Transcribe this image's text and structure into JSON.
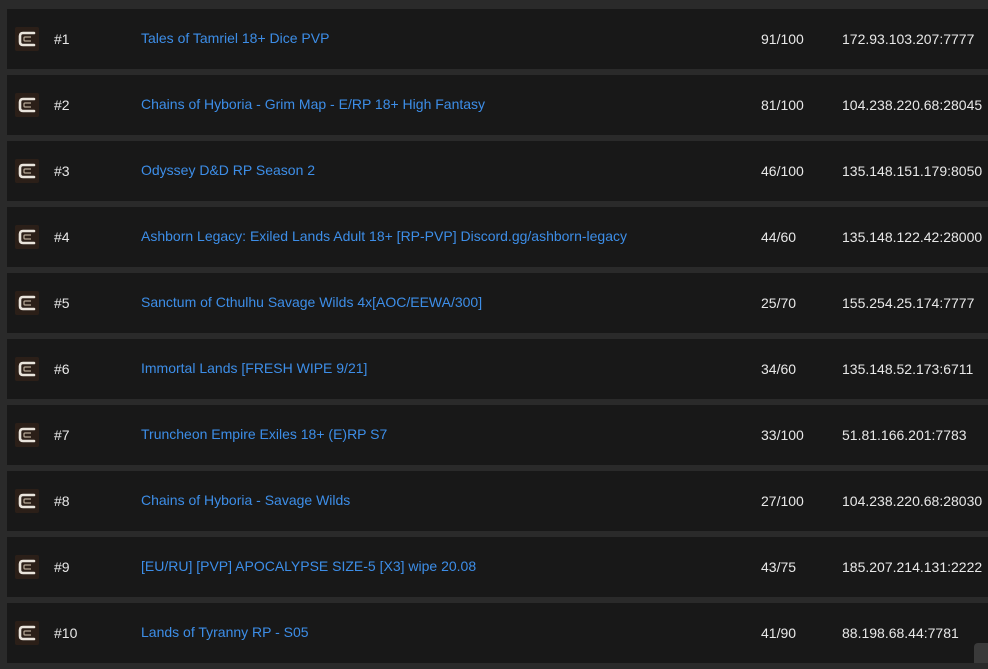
{
  "servers": [
    {
      "rank": "#1",
      "name": "Tales of Tamriel 18+ Dice PVP",
      "players": "91/100",
      "address": "172.93.103.207:7777",
      "icon": "game-logo-icon"
    },
    {
      "rank": "#2",
      "name": "Chains of Hyboria - Grim Map - E/RP 18+ High Fantasy",
      "players": "81/100",
      "address": "104.238.220.68:28045",
      "icon": "game-logo-icon"
    },
    {
      "rank": "#3",
      "name": "Odyssey D&D RP Season 2",
      "players": "46/100",
      "address": "135.148.151.179:8050",
      "icon": "game-logo-icon"
    },
    {
      "rank": "#4",
      "name": "Ashborn Legacy: Exiled Lands Adult 18+ [RP-PVP] Discord.gg/ashborn-legacy",
      "players": "44/60",
      "address": "135.148.122.42:28000",
      "icon": "game-logo-icon"
    },
    {
      "rank": "#5",
      "name": "Sanctum of Cthulhu Savage Wilds 4x[AOC/EEWA/300]",
      "players": "25/70",
      "address": "155.254.25.174:7777",
      "icon": "game-logo-icon"
    },
    {
      "rank": "#6",
      "name": "Immortal Lands [FRESH WIPE 9/21]",
      "players": "34/60",
      "address": "135.148.52.173:6711",
      "icon": "game-logo-icon"
    },
    {
      "rank": "#7",
      "name": "Truncheon Empire Exiles 18+ (E)RP S7",
      "players": "33/100",
      "address": "51.81.166.201:7783",
      "icon": "game-logo-icon"
    },
    {
      "rank": "#8",
      "name": "Chains of Hyboria - Savage Wilds",
      "players": "27/100",
      "address": "104.238.220.68:28030",
      "icon": "game-logo-icon"
    },
    {
      "rank": "#9",
      "name": "[EU/RU] [PVP] APOCALYPSE SIZE-5 [X3] wipe 20.08",
      "players": "43/75",
      "address": "185.207.214.131:2222",
      "icon": "game-logo-icon"
    },
    {
      "rank": "#10",
      "name": "Lands of Tyranny RP - S05",
      "players": "41/90",
      "address": "88.198.68.44:7781",
      "icon": "game-logo-icon"
    }
  ],
  "colors": {
    "background": "#2a2a2a",
    "row": "#181818",
    "link": "#3d8ee8",
    "text": "#e8e8e8"
  }
}
